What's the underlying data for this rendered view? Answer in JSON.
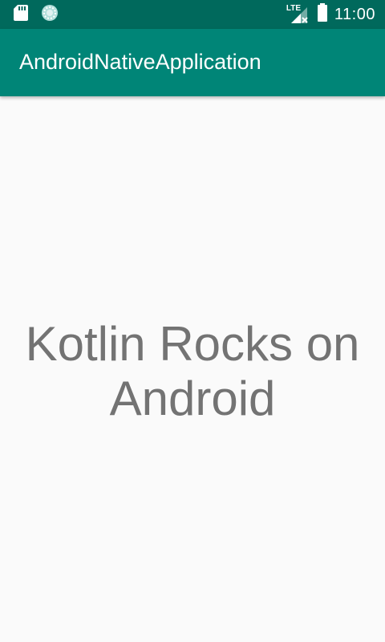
{
  "status_bar": {
    "network_label": "LTE",
    "time": "11:00",
    "icons": [
      "sd-card-icon",
      "loading-spinner-icon",
      "lte-signal-icon",
      "battery-icon"
    ]
  },
  "app_bar": {
    "title": "AndroidNativeApplication"
  },
  "content": {
    "message": "Kotlin Rocks on Android"
  },
  "colors": {
    "status_bar": "#00695c",
    "app_bar": "#008577",
    "background": "#fafafa",
    "message_text": "#737373"
  }
}
